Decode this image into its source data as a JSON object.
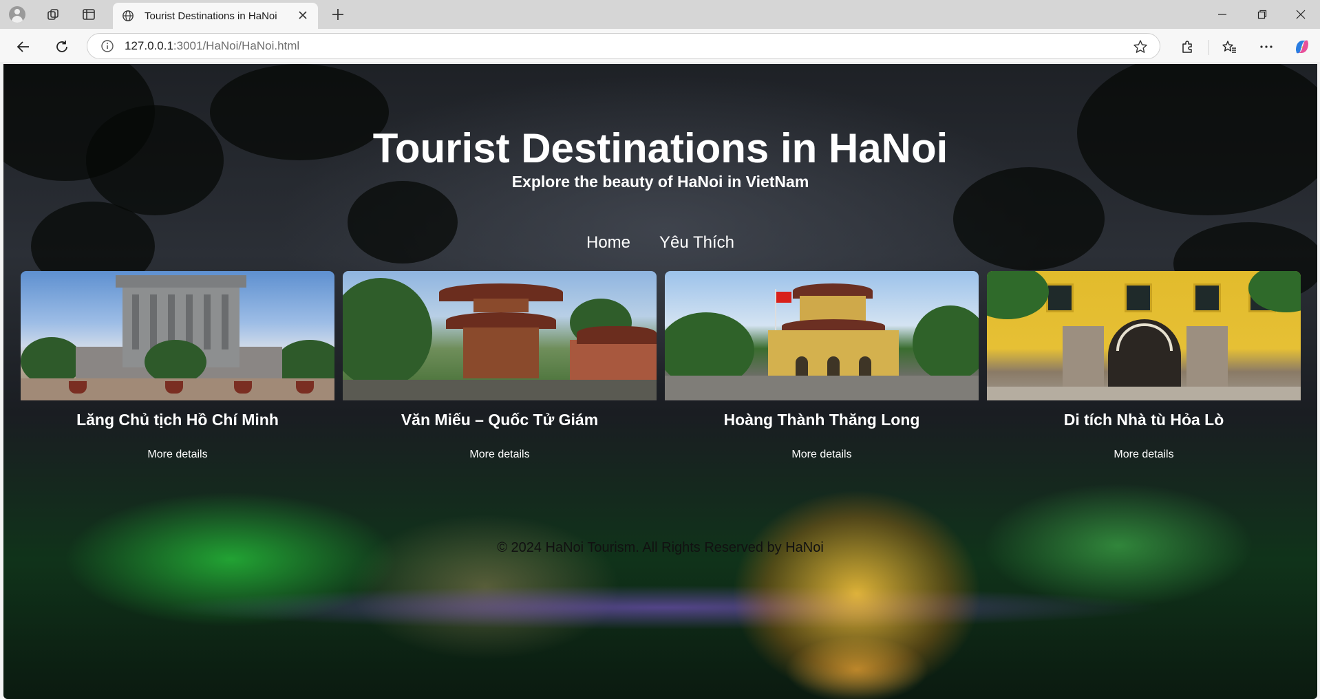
{
  "browser": {
    "tab_title": "Tourist Destinations in HaNoi",
    "url_host": "127.0.0.1",
    "url_path": ":3001/HaNoi/HaNoi.html"
  },
  "page": {
    "title": "Tourist Destinations in HaNoi",
    "subtitle": "Explore the beauty of HaNoi in VietNam",
    "menu": [
      {
        "label": "Home"
      },
      {
        "label": "Yêu Thích"
      }
    ],
    "cards": [
      {
        "name": "Lăng Chủ tịch Hồ Chí Minh",
        "link": "More details"
      },
      {
        "name": "Văn Miếu – Quốc Tử Giám",
        "link": "More details"
      },
      {
        "name": "Hoàng Thành Thăng Long",
        "link": "More details"
      },
      {
        "name": "Di tích Nhà tù Hỏa Lò",
        "link": "More details"
      }
    ],
    "footer": "© 2024 HaNoi Tourism. All Rights Reserved by HaNoi"
  }
}
